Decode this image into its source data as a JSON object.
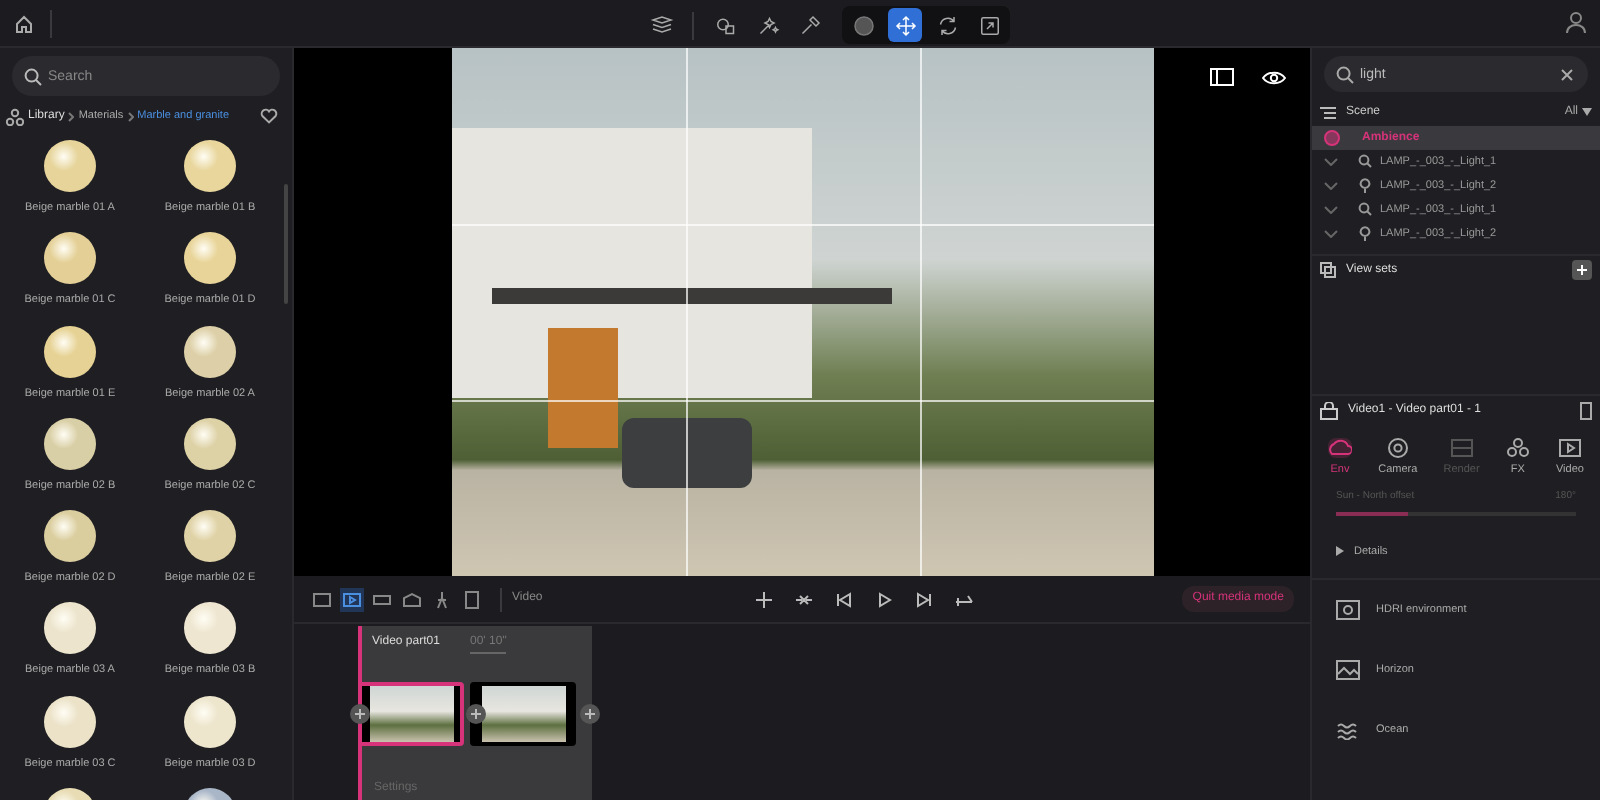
{
  "toolbar": {
    "tools": [
      {
        "kind": "layers",
        "selected": false
      },
      {
        "kind": "shapes",
        "selected": false
      },
      {
        "kind": "sparkle",
        "selected": false
      },
      {
        "kind": "dropper",
        "selected": false
      },
      {
        "kind": "dot",
        "selected": false
      },
      {
        "kind": "move",
        "selected": true
      },
      {
        "kind": "rotate",
        "selected": false
      },
      {
        "kind": "scale",
        "selected": false
      }
    ]
  },
  "library": {
    "search": {
      "placeholder": "Search"
    },
    "breadcrumb": [
      "Library",
      "Materials",
      "Marble and granite"
    ],
    "materials": [
      {
        "label": "Beige marble 01 A",
        "color": "#e6d49a"
      },
      {
        "label": "Beige marble 01 B",
        "color": "#e8d69c"
      },
      {
        "label": "Beige marble 01 C",
        "color": "#e4d096"
      },
      {
        "label": "Beige marble 01 D",
        "color": "#e8d498"
      },
      {
        "label": "Beige marble 01 E",
        "color": "#e6d294"
      },
      {
        "label": "Beige marble 02 A",
        "color": "#ddd0a8"
      },
      {
        "label": "Beige marble 02 B",
        "color": "#d9cfa6"
      },
      {
        "label": "Beige marble 02 C",
        "color": "#ddd1a6"
      },
      {
        "label": "Beige marble 02 D",
        "color": "#dacd9e"
      },
      {
        "label": "Beige marble 02 E",
        "color": "#dfd2a6"
      },
      {
        "label": "Beige marble 03 A",
        "color": "#ece4cc"
      },
      {
        "label": "Beige marble 03 B",
        "color": "#eee6d0"
      },
      {
        "label": "Beige marble 03 C",
        "color": "#ebe2c8"
      },
      {
        "label": "Beige marble 03 D",
        "color": "#ede5cc"
      },
      {
        "color": "#e8dcb4"
      },
      {
        "color": "#a9b6c8"
      }
    ]
  },
  "viewport": {
    "grid": true
  },
  "timeline_toolbar": {
    "mode_label": "Video",
    "quit_button": "Quit media mode"
  },
  "timeline": {
    "track": {
      "title": "Video part01",
      "duration": "00' 10''",
      "settings": "Settings"
    },
    "clips": [
      {
        "selected": true
      },
      {
        "selected": false
      }
    ]
  },
  "outliner": {
    "search": {
      "value": "light"
    },
    "scene_label": "Scene",
    "filter": "All",
    "items": [
      {
        "label": "Ambience",
        "kind": "ambience",
        "selected": true
      },
      {
        "label": "LAMP_-_003_-_Light_1",
        "kind": "spot",
        "selected": false
      },
      {
        "label": "LAMP_-_003_-_Light_2",
        "kind": "point",
        "selected": false
      },
      {
        "label": "LAMP_-_003_-_Light_1",
        "kind": "spot",
        "selected": false
      },
      {
        "label": "LAMP_-_003_-_Light_2",
        "kind": "point",
        "selected": false
      }
    ],
    "view_sets": "View sets"
  },
  "properties": {
    "title": "Video1 - Video part01 - 1",
    "tabs": [
      {
        "label": "Env",
        "selected": true,
        "disabled": false
      },
      {
        "label": "Camera",
        "selected": false,
        "disabled": false
      },
      {
        "label": "Render",
        "selected": false,
        "disabled": true
      },
      {
        "label": "FX",
        "selected": false,
        "disabled": false
      },
      {
        "label": "Video",
        "selected": false,
        "disabled": false
      }
    ],
    "slider": {
      "label": "Sun - North offset",
      "reading": "180°",
      "level": 0.3
    },
    "details": "Details",
    "sections": [
      "HDRI environment",
      "Horizon",
      "Ocean"
    ]
  }
}
